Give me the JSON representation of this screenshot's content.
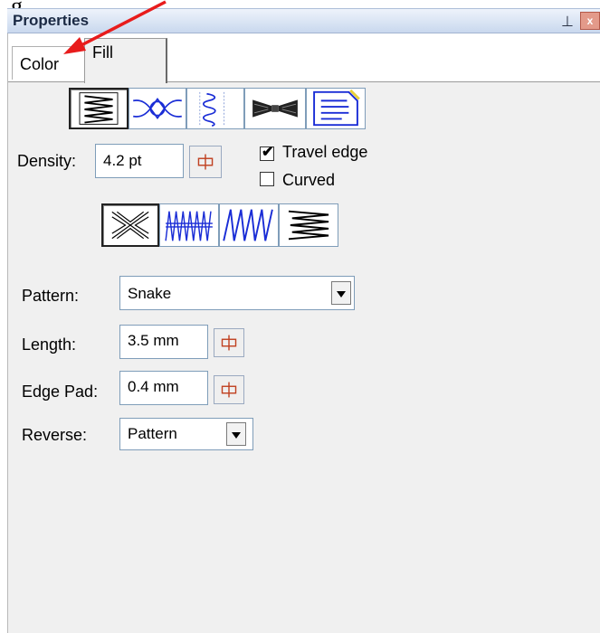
{
  "annotation": {
    "text": "g"
  },
  "panel": {
    "title": "Properties",
    "pin_glyph": "⊥",
    "close_glyph": "x"
  },
  "tabs": [
    {
      "label": "Color"
    },
    {
      "label": "Fill"
    }
  ],
  "stitch_types": [
    {
      "name": "satin-zigzag",
      "selected": true
    },
    {
      "name": "decorative-loops",
      "selected": false
    },
    {
      "name": "spiral-wave",
      "selected": false
    },
    {
      "name": "bowtie-fill",
      "selected": false
    },
    {
      "name": "notes-fill",
      "selected": false
    }
  ],
  "density": {
    "label": "Density:",
    "value": "4.2 pt"
  },
  "travel_edge": {
    "label": "Travel edge",
    "checked": true
  },
  "curved": {
    "label": "Curved",
    "checked": false
  },
  "patterns": [
    {
      "name": "x-cross",
      "selected": true
    },
    {
      "name": "vertical-zigzag",
      "selected": false
    },
    {
      "name": "diagonal-zigzag",
      "selected": false
    },
    {
      "name": "horizontal-zigzag",
      "selected": false
    }
  ],
  "pattern": {
    "label": "Pattern:",
    "value": "Snake"
  },
  "length": {
    "label": "Length:",
    "value": "3.5 mm"
  },
  "edge_pad": {
    "label": "Edge Pad:",
    "value": "0.4 mm"
  },
  "reverse": {
    "label": "Reverse:",
    "value": "Pattern"
  },
  "colors": {
    "title_text": "#1b2a44",
    "close_button": "#e39a8a",
    "arrow": "#e81c1c",
    "stitch_blue": "#1a2dd6",
    "panel_bg": "#f0f0f0"
  }
}
